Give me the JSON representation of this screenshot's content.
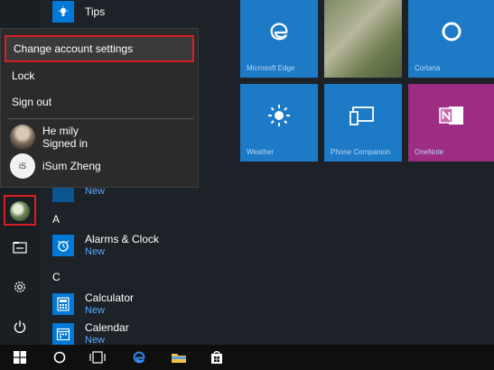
{
  "app_list": {
    "tips_label": "Tips",
    "new_label": "New",
    "section_a": "A",
    "section_c": "C",
    "alarms_label": "Alarms & Clock",
    "calculator_label": "Calculator",
    "calendar_label": "Calendar"
  },
  "account_flyout": {
    "change_account_settings": "Change account settings",
    "lock": "Lock",
    "sign_out": "Sign out",
    "user1_name": "He mily",
    "user1_status": "Signed in",
    "user2_name": "iSum Zheng",
    "user2_avatar_text": "iS"
  },
  "tiles": {
    "edge_label": "Microsoft Edge",
    "photos_label": "",
    "cortana_label": "Cortana",
    "weather_label": "Weather",
    "phone_label": "Phone Companion",
    "onenote_label": "OneNote"
  },
  "colors": {
    "accent": "#0078d7",
    "highlight_border": "#d71f26",
    "onenote": "#9c2d83"
  }
}
